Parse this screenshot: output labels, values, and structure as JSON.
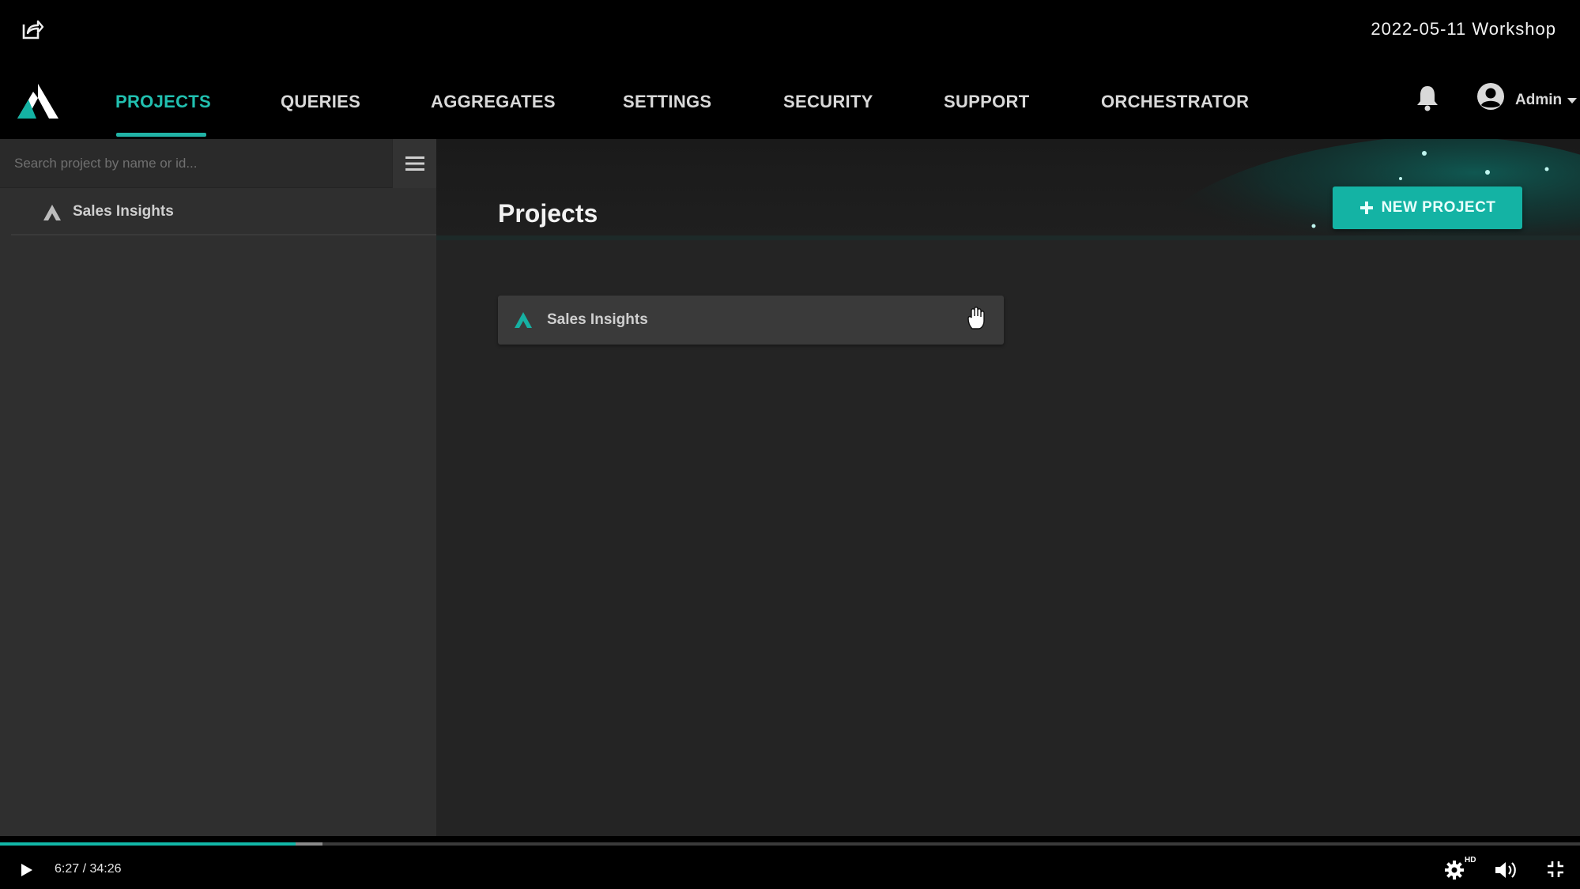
{
  "video": {
    "title": "2022-05-11 Workshop",
    "current_time": "6:27",
    "duration": "34:26",
    "time_display": "6:27 / 34:26",
    "progress_fraction": 0.1873,
    "buffered_fraction": 0.204,
    "hd_badge": "HD",
    "icons": [
      "share-icon",
      "play-icon",
      "gear-icon",
      "volume-icon",
      "exit-fullscreen-icon"
    ]
  },
  "header": {
    "nav": [
      {
        "label": "PROJECTS",
        "active": true
      },
      {
        "label": "QUERIES",
        "active": false
      },
      {
        "label": "AGGREGATES",
        "active": false
      },
      {
        "label": "SETTINGS",
        "active": false
      },
      {
        "label": "SECURITY",
        "active": false
      },
      {
        "label": "SUPPORT",
        "active": false
      },
      {
        "label": "ORCHESTRATOR",
        "active": false
      }
    ],
    "user_label": "Admin",
    "icons": [
      "logo-icon",
      "bell-icon",
      "user-avatar-icon",
      "caret-down-icon"
    ]
  },
  "sidebar": {
    "search_placeholder": "Search project by name or id...",
    "search_value": "",
    "items": [
      {
        "label": "Sales Insights"
      }
    ]
  },
  "main": {
    "page_title": "Projects",
    "new_project_label": "NEW PROJECT",
    "projects": [
      {
        "label": "Sales Insights"
      }
    ]
  },
  "colors": {
    "accent": "#21c0b0",
    "button": "#14b3a4",
    "sidebar_bg": "#2f2f2f",
    "main_bg": "#242424",
    "header_bg": "#000000"
  }
}
